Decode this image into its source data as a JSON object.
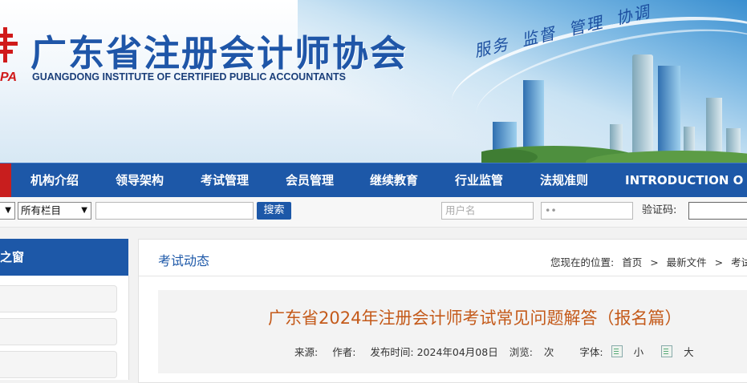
{
  "header": {
    "logo_letters": "PA",
    "title_cn": "广东省注册会计师协会",
    "title_en": "GUANGDONG INSTITUTE OF CERTIFIED PUBLIC ACCOUNTANTS",
    "slogan": [
      "服务",
      "监督",
      "管理",
      "协调"
    ]
  },
  "nav": {
    "items": [
      "机构介绍",
      "领导架构",
      "考试管理",
      "会员管理",
      "继续教育",
      "行业监管",
      "法规准则",
      "INTRODUCTION O"
    ]
  },
  "search": {
    "column_select": "所有栏目",
    "keyword_placeholder": "",
    "search_label": "搜索",
    "username_placeholder": "用户名",
    "password_mask": "••",
    "captcha_label": "验证码:"
  },
  "sidebar": {
    "title": "之窗"
  },
  "main": {
    "section_title": "考试动态",
    "breadcrumb": [
      "您现在的位置:",
      "首页",
      ">",
      "最新文件",
      ">",
      "考试"
    ],
    "article": {
      "title": "广东省2024年注册会计师考试常见问题解答（报名篇）",
      "source_label": "来源:",
      "author_label": "作者:",
      "published": "发布时间: 2024年04月08日",
      "views_label": "浏览:",
      "views_unit": "次",
      "font_label": "字体:",
      "font_small": "小",
      "font_large": "大"
    }
  },
  "colors": {
    "brand_blue": "#1d58a8",
    "accent_red": "#c81e1e",
    "article_title": "#c45a1a"
  }
}
